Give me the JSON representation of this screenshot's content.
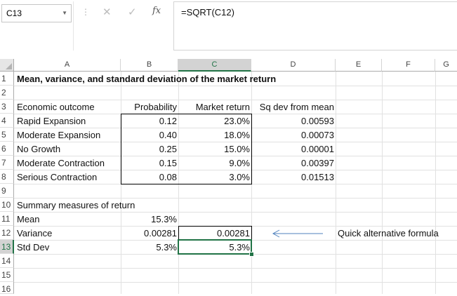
{
  "formula_bar": {
    "name_box": "C13",
    "cancel_icon": "✕",
    "enter_icon": "✓",
    "fx_label": "fx",
    "formula": "=SQRT(C12)"
  },
  "columns": [
    "A",
    "B",
    "C",
    "D",
    "E",
    "F",
    "G"
  ],
  "rows": [
    "1",
    "2",
    "3",
    "4",
    "5",
    "6",
    "7",
    "8",
    "9",
    "10",
    "11",
    "12",
    "13",
    "14",
    "15",
    "16"
  ],
  "sheet": {
    "title": "Mean, variance, and standard deviation of the market return",
    "headers": {
      "outcome": "Economic outcome",
      "probability": "Probability",
      "market_return": "Market return",
      "sq_dev": "Sq dev from mean"
    },
    "outcomes": [
      {
        "name": "Rapid Expansion",
        "probability": "0.12",
        "return": "23.0%",
        "sq_dev": "0.00593"
      },
      {
        "name": "Moderate Expansion",
        "probability": "0.40",
        "return": "18.0%",
        "sq_dev": "0.00073"
      },
      {
        "name": "No Growth",
        "probability": "0.25",
        "return": "15.0%",
        "sq_dev": "0.00001"
      },
      {
        "name": "Moderate Contraction",
        "probability": "0.15",
        "return": "9.0%",
        "sq_dev": "0.00397"
      },
      {
        "name": "Serious Contraction",
        "probability": "0.08",
        "return": "3.0%",
        "sq_dev": "0.01513"
      }
    ],
    "summary_label": "Summary measures of return",
    "mean": {
      "label": "Mean",
      "value": "15.3%"
    },
    "variance": {
      "label": "Variance",
      "value": "0.00281",
      "alt_value": "0.00281"
    },
    "std_dev": {
      "label": "Std Dev",
      "value": "5.3%",
      "alt_value": "5.3%"
    },
    "note": "Quick alternative formula"
  },
  "colors": {
    "selection": "#217346",
    "arrow": "#4f81bd"
  }
}
